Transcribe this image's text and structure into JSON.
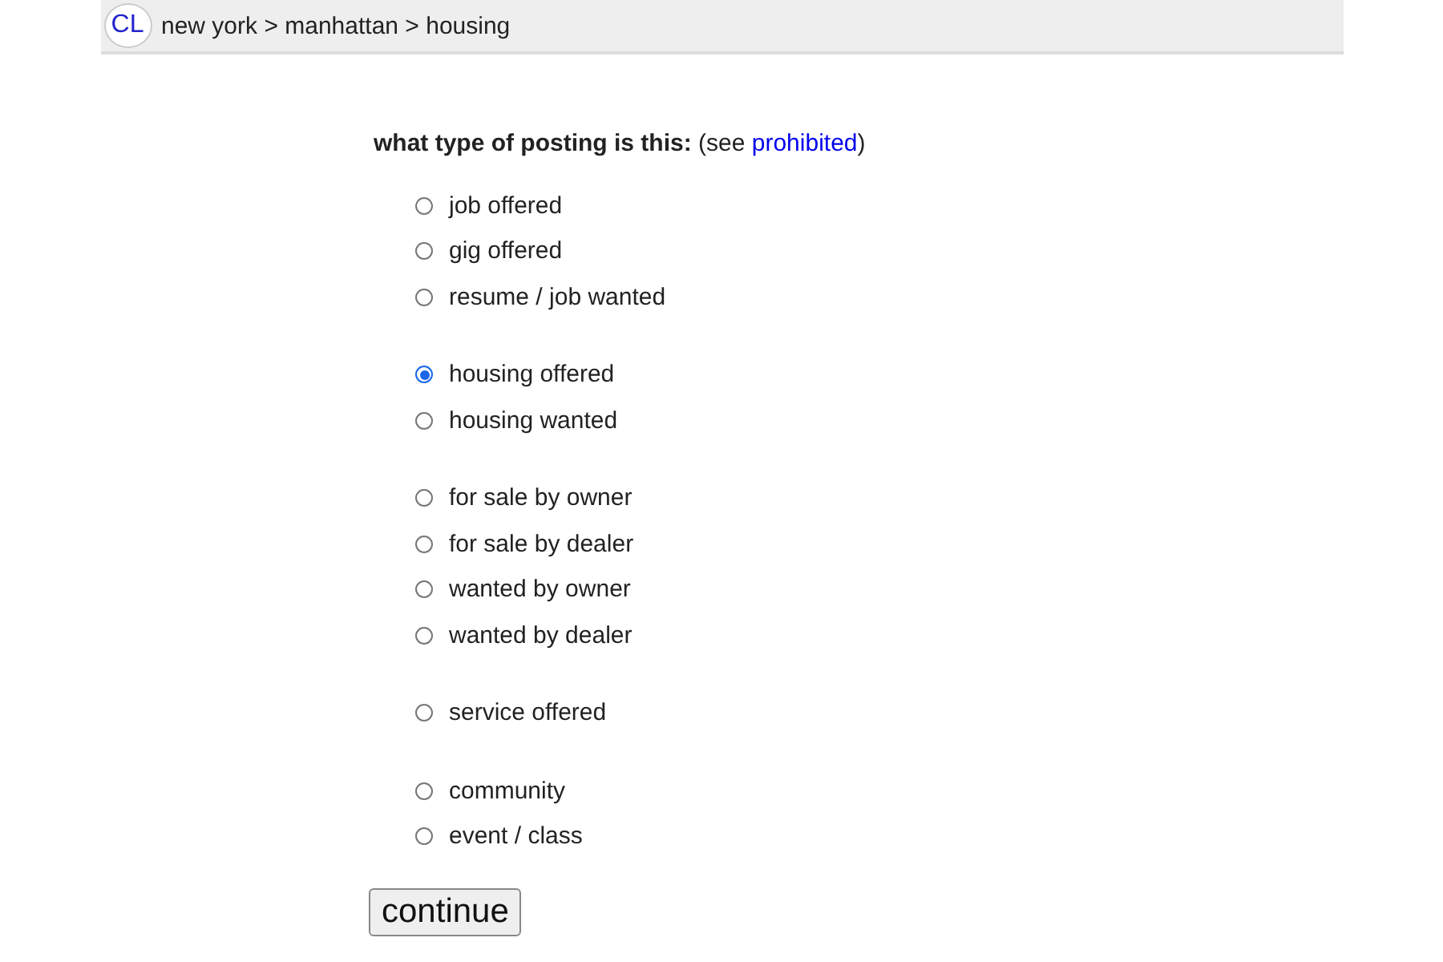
{
  "header": {
    "logo": "CL",
    "breadcrumb": "new york > manhattan > housing"
  },
  "question": {
    "label": "what type of posting is this:",
    "note_before": "(see",
    "link": "prohibited",
    "note_after": ")"
  },
  "groups": [
    {
      "options": [
        {
          "label": "job offered",
          "selected": false
        },
        {
          "label": "gig offered",
          "selected": false
        },
        {
          "label": "resume / job wanted",
          "selected": false
        }
      ]
    },
    {
      "options": [
        {
          "label": "housing offered",
          "selected": true
        },
        {
          "label": "housing wanted",
          "selected": false
        }
      ]
    },
    {
      "options": [
        {
          "label": "for sale by owner",
          "selected": false
        },
        {
          "label": "for sale by dealer",
          "selected": false
        },
        {
          "label": "wanted by owner",
          "selected": false
        },
        {
          "label": "wanted by dealer",
          "selected": false
        }
      ]
    },
    {
      "options": [
        {
          "label": "service offered",
          "selected": false
        }
      ]
    },
    {
      "options": [
        {
          "label": "community",
          "selected": false
        },
        {
          "label": "event / class",
          "selected": false
        }
      ]
    }
  ],
  "button": "continue"
}
